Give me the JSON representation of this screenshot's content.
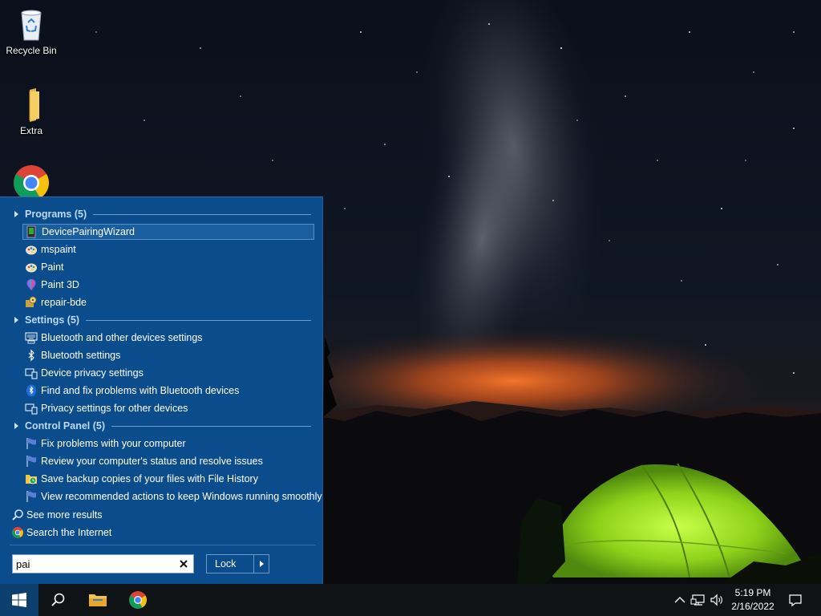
{
  "desktop": {
    "icons": [
      {
        "label": "Recycle Bin",
        "icon": "recycle-bin-icon"
      },
      {
        "label": "Extra",
        "icon": "folder-icon"
      },
      {
        "label": "Google Chrome",
        "icon": "chrome-icon"
      }
    ]
  },
  "start_menu": {
    "sections": [
      {
        "title": "Programs (5)",
        "items": [
          {
            "label": "DevicePairingWizard",
            "icon": "device-pairing-icon",
            "selected": true
          },
          {
            "label": "mspaint",
            "icon": "paint-palette-icon"
          },
          {
            "label": "Paint",
            "icon": "paint-palette-icon"
          },
          {
            "label": "Paint 3D",
            "icon": "paint-3d-icon"
          },
          {
            "label": "repair-bde",
            "icon": "repair-bde-icon"
          }
        ]
      },
      {
        "title": "Settings (5)",
        "items": [
          {
            "label": "Bluetooth and other devices settings",
            "icon": "keyboard-devices-icon"
          },
          {
            "label": "Bluetooth settings",
            "icon": "bluetooth-icon"
          },
          {
            "label": "Device privacy settings",
            "icon": "devices-icon"
          },
          {
            "label": "Find and fix problems with Bluetooth devices",
            "icon": "bluetooth-troubleshoot-icon"
          },
          {
            "label": "Privacy settings for other devices",
            "icon": "devices-icon"
          }
        ]
      },
      {
        "title": "Control Panel (5)",
        "items": [
          {
            "label": "Fix problems with your computer",
            "icon": "action-center-flag-icon"
          },
          {
            "label": "Review your computer's status and resolve issues",
            "icon": "action-center-flag-icon"
          },
          {
            "label": "Save backup copies of your files with File History",
            "icon": "file-history-icon"
          },
          {
            "label": "View recommended actions to keep Windows running smoothly",
            "icon": "action-center-flag-icon"
          }
        ]
      }
    ],
    "see_more": "See more results",
    "search_internet": "Search the Internet",
    "search": {
      "value": "pai"
    },
    "lock_label": "Lock"
  },
  "taskbar": {
    "time": "5:19 PM",
    "date": "2/16/2022"
  },
  "colors": {
    "menu_bg": "#0b4d8c",
    "section_title": "#bcd9f7",
    "taskbar_bg": "#101316",
    "tent": "#8ed21a"
  }
}
